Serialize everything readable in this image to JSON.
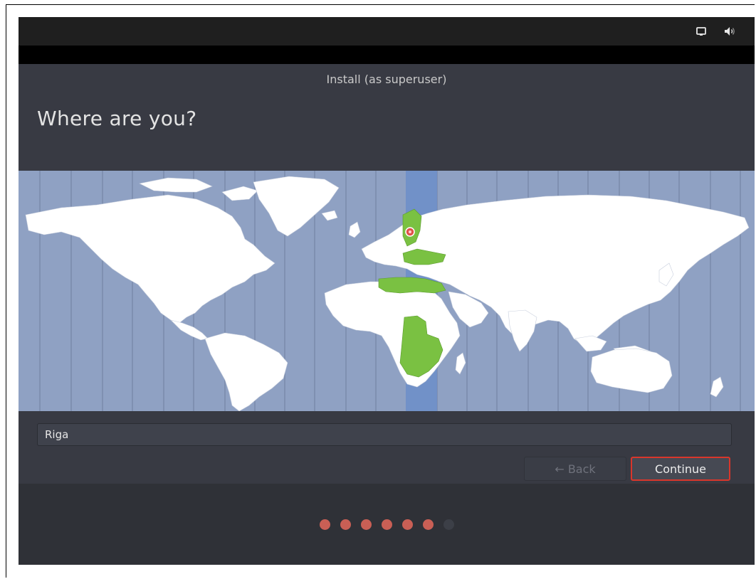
{
  "window": {
    "title": "Install (as superuser)"
  },
  "page": {
    "heading": "Where are you?"
  },
  "timezone": {
    "value": "Riga",
    "selected_zone_color": "#6e8fc9",
    "highlight_color": "#7ac142",
    "pin_color": "#e0524a"
  },
  "buttons": {
    "back_label": "← Back",
    "continue_label": "Continue"
  },
  "tray": {
    "icons": [
      "display-icon",
      "volume-icon"
    ]
  },
  "progress": {
    "total_steps": 7,
    "completed_steps": 6
  },
  "colors": {
    "accent": "#d9362b",
    "dot_active": "#c95f55",
    "map_ocean": "#8fa1c3",
    "land": "#ffffff"
  }
}
